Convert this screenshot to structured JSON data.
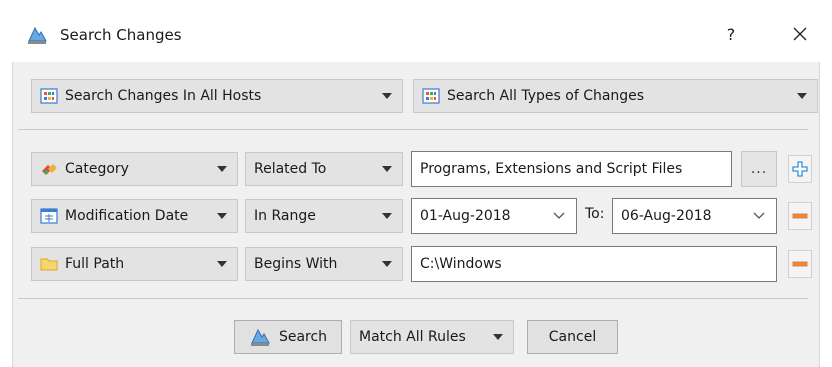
{
  "window": {
    "title": "Search Changes",
    "help_label": "?",
    "close_icon": "close-icon",
    "app_icon": "diskpulse-icon"
  },
  "scope": {
    "hosts_combo": "Search Changes In All Hosts",
    "types_combo": "Search All Types of Changes",
    "icon": "grid-icon"
  },
  "rules": [
    {
      "field": "Category",
      "field_icon": "category-icon",
      "operator": "Related To",
      "value": "Programs, Extensions and Script Files",
      "browse_label": "...",
      "action": "add"
    },
    {
      "field": "Modification Date",
      "field_icon": "calendar-icon",
      "operator": "In Range",
      "from": "01-Aug-2018",
      "to_label": "To:",
      "to": "06-Aug-2018",
      "action": "remove"
    },
    {
      "field": "Full Path",
      "field_icon": "folder-icon",
      "operator": "Begins With",
      "value": "C:\\Windows",
      "action": "remove"
    }
  ],
  "footer": {
    "search_label": "Search",
    "match_combo": "Match All Rules",
    "cancel_label": "Cancel"
  },
  "colors": {
    "plus": "#3a8fd6",
    "minus": "#f08a3a",
    "icon_blue": "#3a7bd5"
  }
}
